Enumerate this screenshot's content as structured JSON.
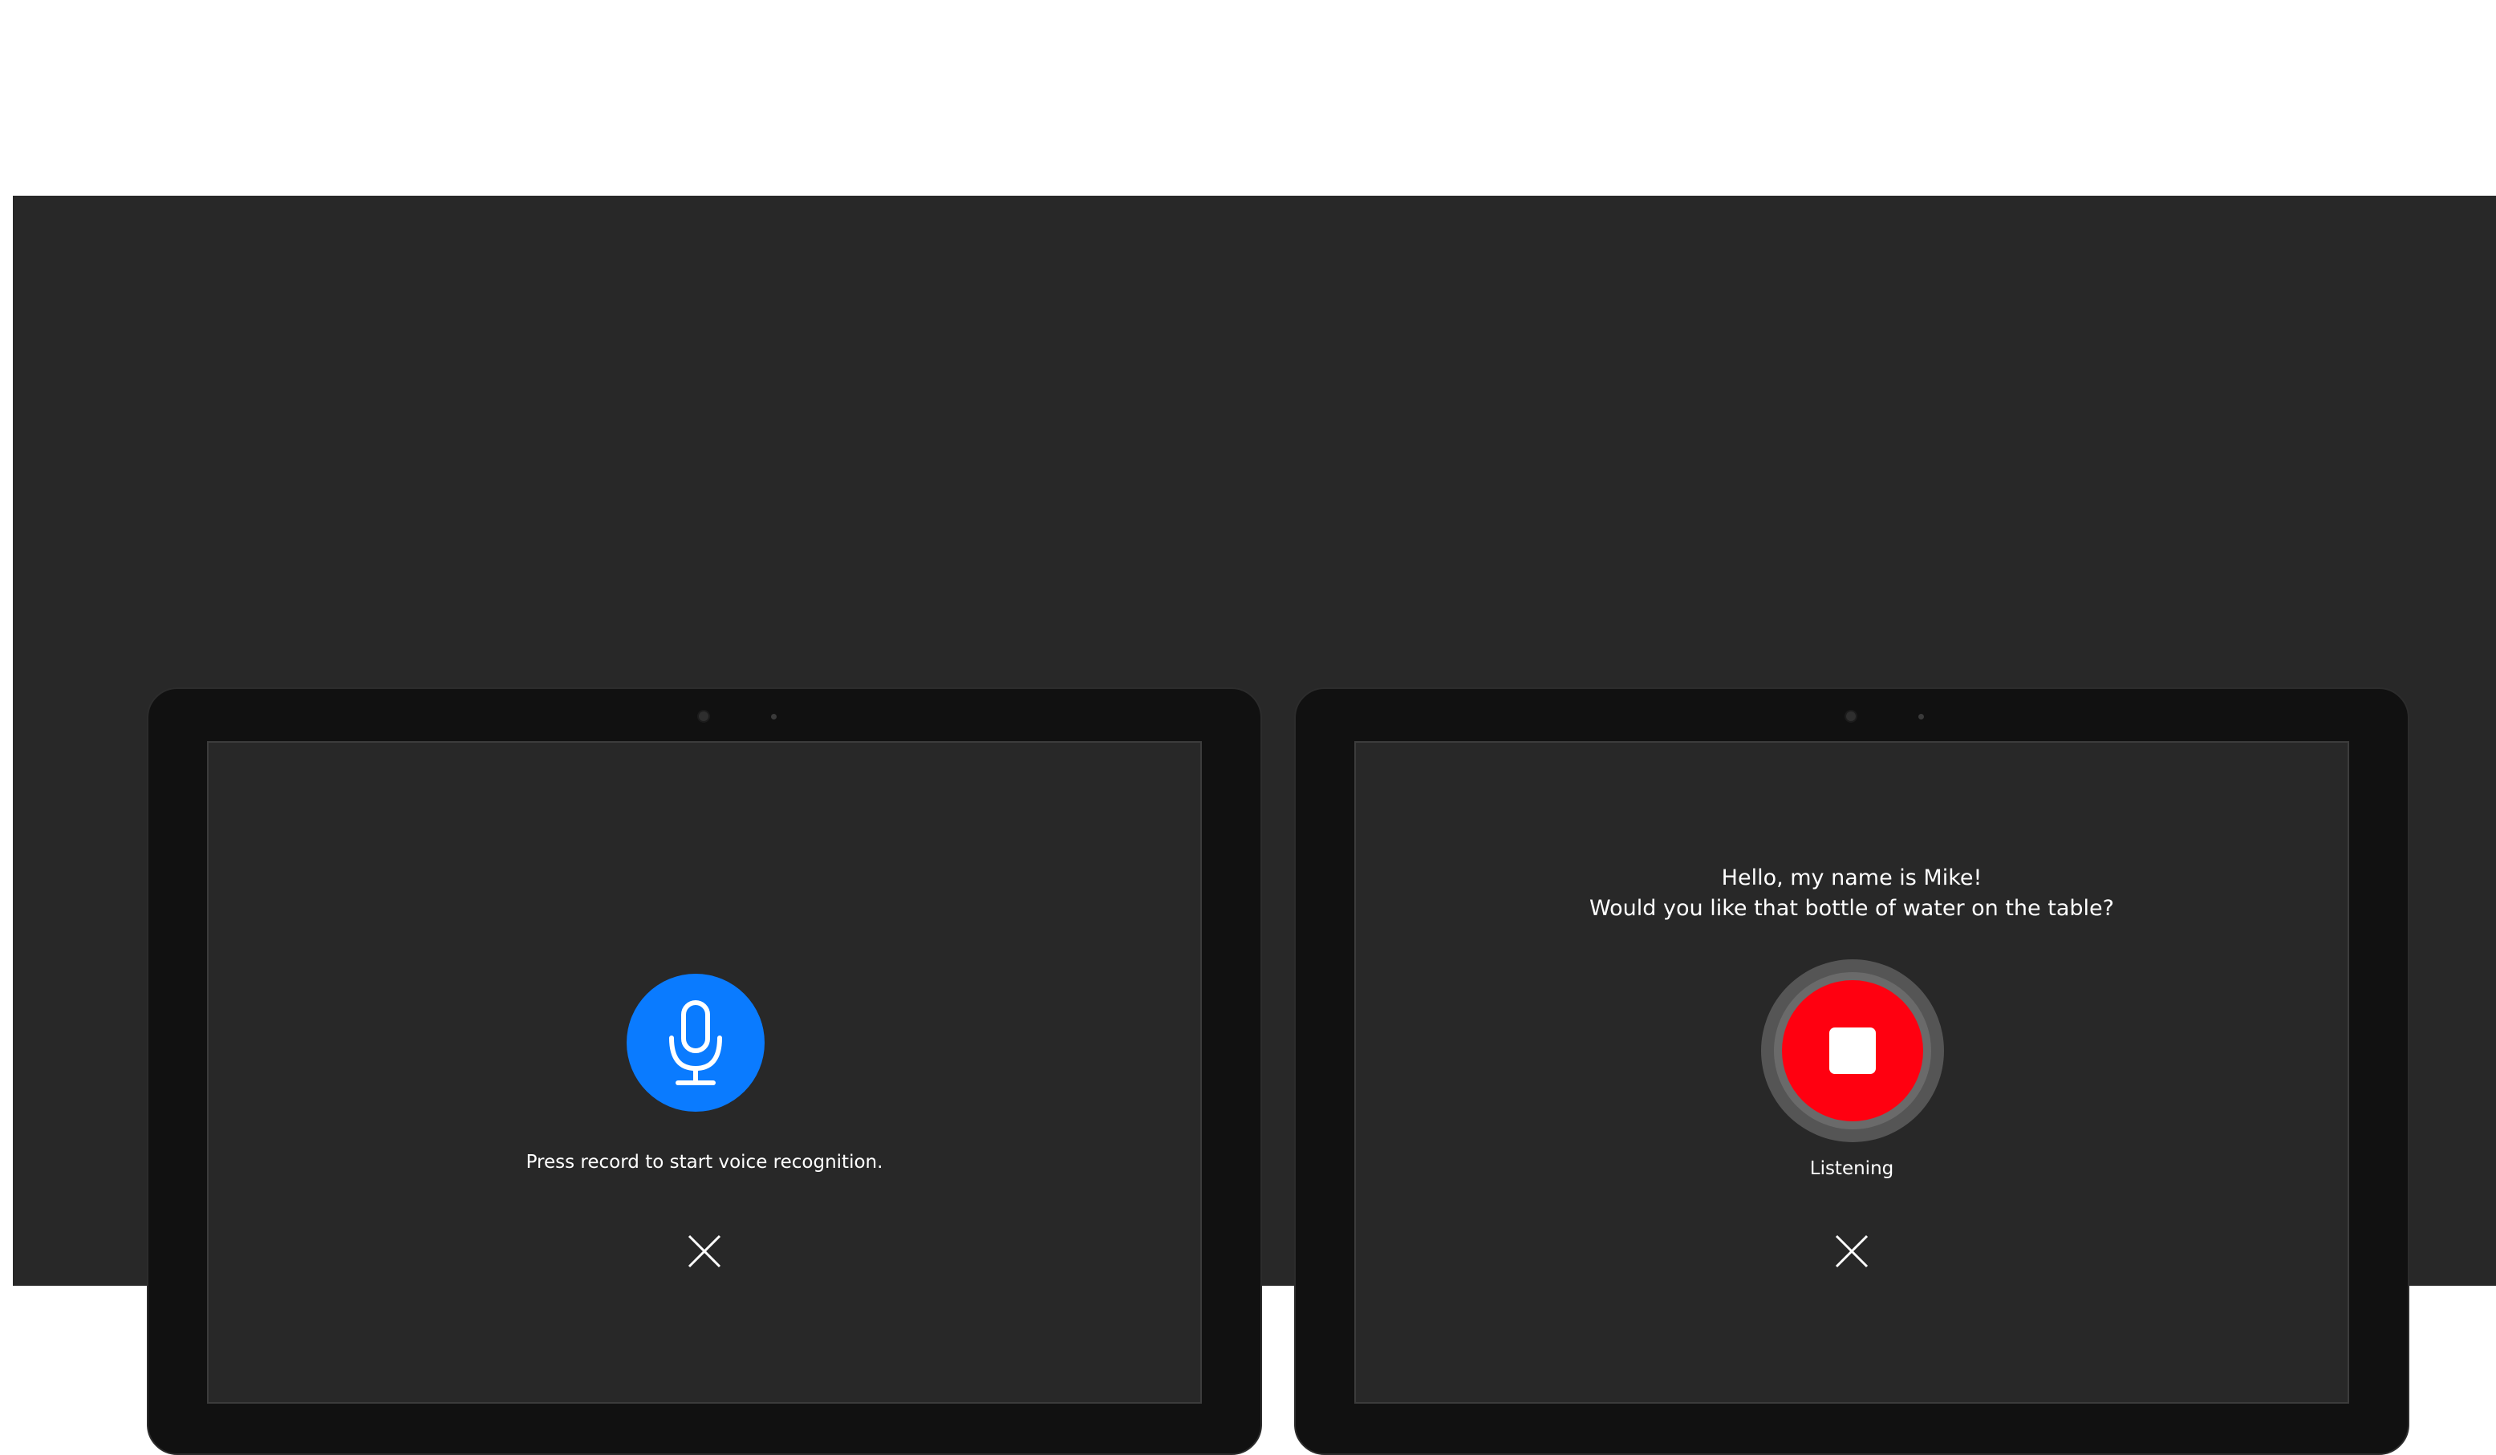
{
  "colors": {
    "stage_background": "#282828",
    "tablet_bezel": "#111111",
    "record_blue": "#0a7bff",
    "stop_red": "#ff0010",
    "text": "#ffffff"
  },
  "left_tablet": {
    "mic_icon": "microphone-icon",
    "instruction": "Press record to start voice recognition.",
    "close_icon": "close-icon"
  },
  "right_tablet": {
    "transcript_line_1": "Hello, my name is Mike!",
    "transcript_line_2": "Would you like that bottle of water on the table?",
    "stop_icon": "stop-icon",
    "status": "Listening",
    "close_icon": "close-icon"
  }
}
